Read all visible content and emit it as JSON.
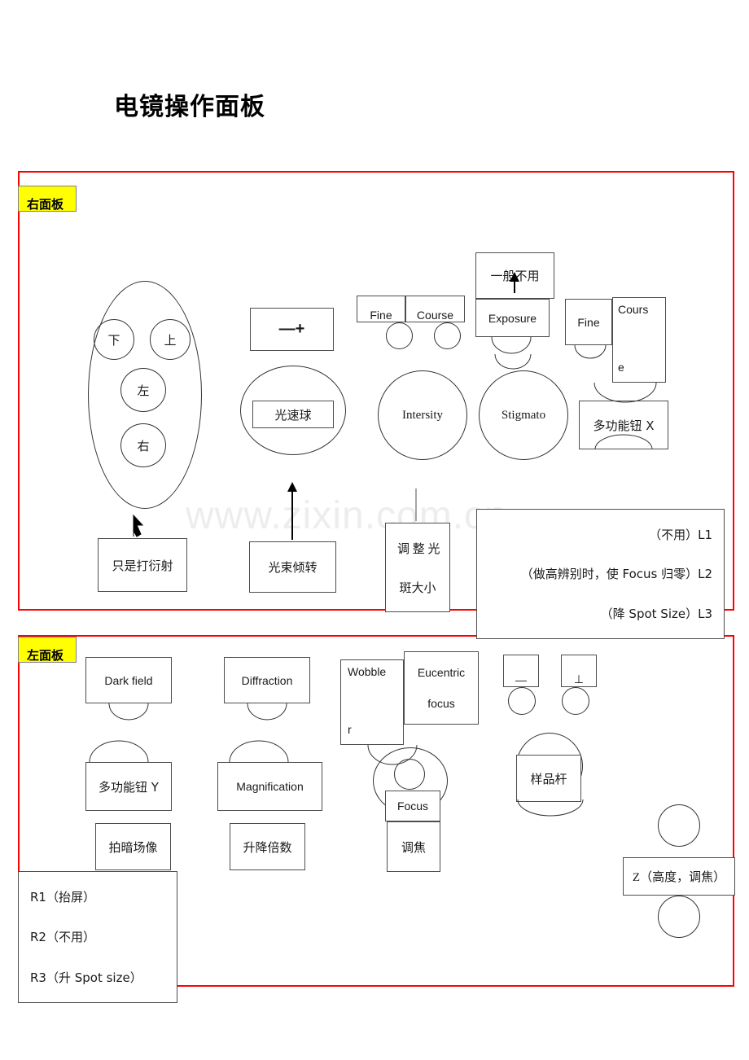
{
  "page": {
    "title": "电镜操作面板",
    "watermark": "www.zixin.com.cn"
  },
  "panels": {
    "top": {
      "tag": "右面板"
    },
    "bottom": {
      "tag": "左面板"
    }
  },
  "top_panel": {
    "joystick": {
      "down": "下",
      "up": "上",
      "left": "左",
      "right": "右"
    },
    "minus_plus_box": "—+",
    "beam_ball": "光速球",
    "fine_small": "Fine",
    "course_small": "Course",
    "intersity": "Intersity",
    "stigmato": "Stigmato",
    "generally_unused": "一般不用",
    "exposure": "Exposure",
    "fine": "Fine",
    "course_wrap_1": "Cours",
    "course_wrap_2": "e",
    "multifunction_x": "多功能钮 X",
    "note_diffraction": "只是打衍射",
    "note_beam_tilt": "光束倾转",
    "note_spot_line1": "调 整 光",
    "note_spot_line2": "斑大小",
    "lens_notes": [
      "（不用）L1",
      "（做高辨别时，使 Focus 归零）L2",
      "（降 Spot Size）L3"
    ]
  },
  "bottom_panel": {
    "dark_field": "Dark field",
    "diffraction": "Diffraction",
    "wobbler_line1": "Wobble",
    "wobbler_line2": "r",
    "eucentric_line1": "Eucentric",
    "eucentric_line2": "focus",
    "multifunction_y": "多功能钮 Y",
    "magnification": "Magnification",
    "dark_field_image": "拍暗场像",
    "mag_updown": "升降倍数",
    "focus": "Focus",
    "focus_cn": "调焦",
    "sample_rod": "样品杆",
    "symbol_dash": "—",
    "symbol_perp": "⊥",
    "z_height": "Z（高度，调焦）",
    "r_notes": [
      "R1（抬屏）",
      "R2（不用）",
      "R3（升 Spot size）"
    ]
  }
}
